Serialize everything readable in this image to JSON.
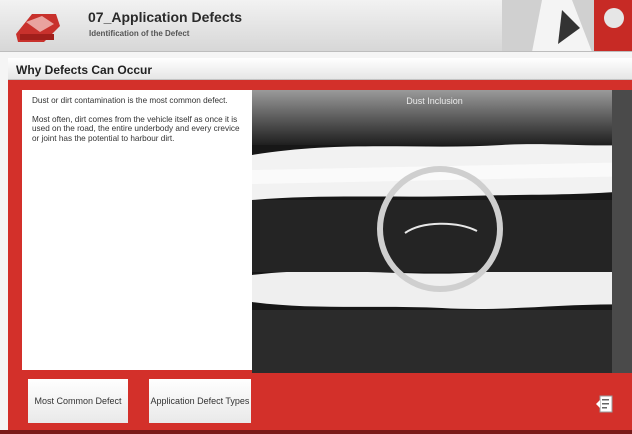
{
  "header": {
    "title": "07_Application Defects",
    "subtitle": "Identification of the Defect",
    "logo_icon": "brand-logo-icon"
  },
  "section": {
    "title": "Why Defects Can Occur"
  },
  "body_text": {
    "p1": "Dust or dirt contamination is the most common defect.",
    "p2": "Most often, dirt comes from the vehicle itself as once it is used on the road, the entire underbody and every crevice or joint has the potential to harbour dirt."
  },
  "photo": {
    "caption": "Dust Inclusion"
  },
  "nav": {
    "btn1_label": "Most Common Defect",
    "btn2_label": "Application Defect Types"
  },
  "icons": {
    "corner": "page-turn-icon"
  },
  "colors": {
    "accent": "#d3302a",
    "header_bg": "#dcdcdc",
    "panel_bg": "#ffffff"
  }
}
